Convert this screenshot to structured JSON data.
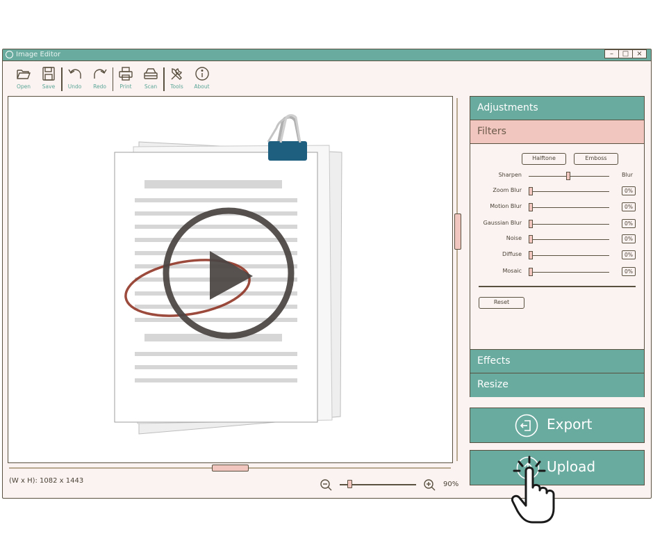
{
  "window": {
    "title": "Image Editor",
    "controls": [
      "–",
      "□",
      "×"
    ]
  },
  "toolbar": {
    "items": [
      {
        "label": "Open",
        "icon": "folder-open-icon"
      },
      {
        "label": "Save",
        "icon": "floppy-save-icon"
      },
      {
        "label": "Undo",
        "icon": "undo-icon"
      },
      {
        "label": "Redo",
        "icon": "redo-icon"
      },
      {
        "label": "Print",
        "icon": "printer-icon"
      },
      {
        "label": "Scan",
        "icon": "scanner-icon"
      },
      {
        "label": "Tools",
        "icon": "tools-icon"
      },
      {
        "label": "About",
        "icon": "info-icon"
      }
    ]
  },
  "canvas": {
    "content": "document-with-play-icon"
  },
  "status": {
    "dimensions": "(W x H): 1082 x 1443",
    "zoom": "90%",
    "zoom_level": 0.1
  },
  "panel": {
    "sections": [
      "Adjustments",
      "Filters",
      "Effects",
      "Resize"
    ],
    "active_section": "Filters",
    "filters": {
      "chips": [
        "Halftone",
        "Emboss"
      ],
      "sharpen": {
        "label": "Sharpen",
        "right_label": "Blur",
        "value": 0.5
      },
      "rows": [
        {
          "label": "Zoom Blur",
          "value": "0%"
        },
        {
          "label": "Motion Blur",
          "value": "0%"
        },
        {
          "label": "Gaussian Blur",
          "value": "0%"
        },
        {
          "label": "Noise",
          "value": "0%"
        },
        {
          "label": "Diffuse",
          "value": "0%"
        },
        {
          "label": "Mosaic",
          "value": "0%"
        }
      ],
      "reset": "Reset"
    }
  },
  "actions": {
    "export": "Export",
    "upload": "Upload"
  },
  "colors": {
    "teal": "#6aab9f",
    "pink": "#f1c6be",
    "outline": "#5a5040",
    "background": "#fbf3f1"
  }
}
